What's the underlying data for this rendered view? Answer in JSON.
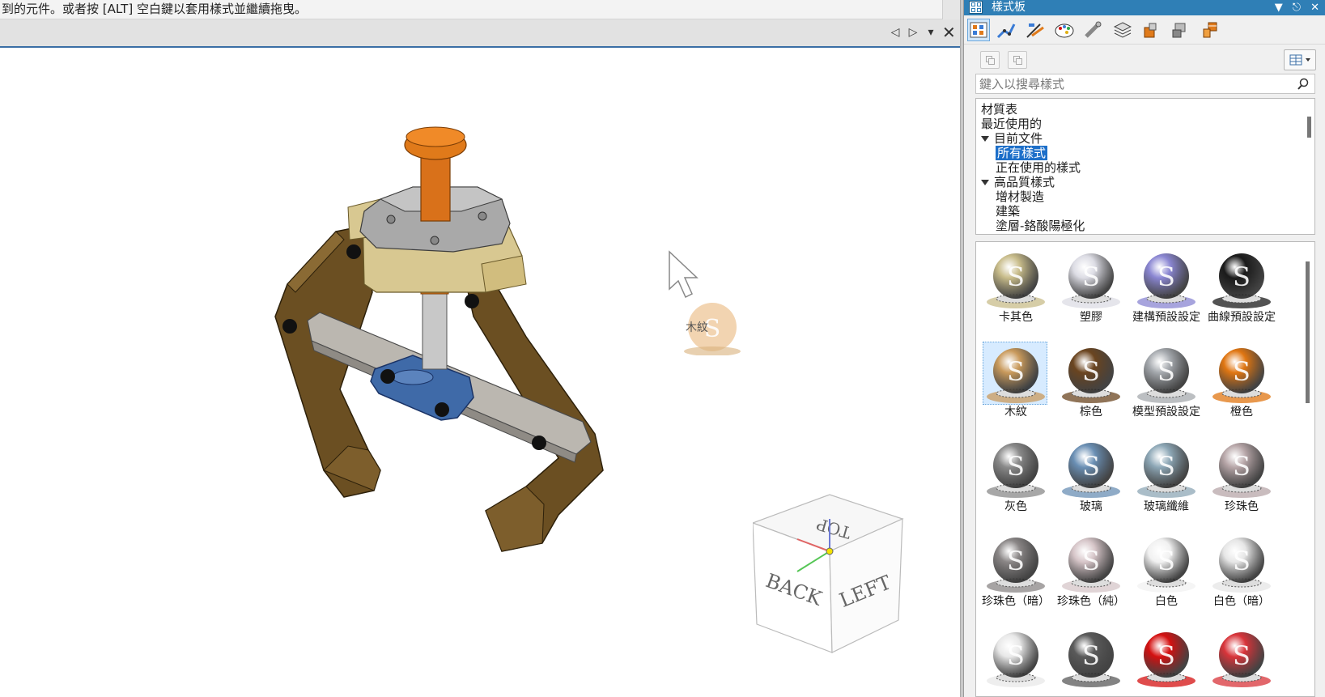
{
  "status_text": "到的元件。或者按 [ALT] 空白鍵以套用樣式並繼續拖曳。",
  "document_tab_controls": {
    "prev_icon": "triangle-left",
    "next_icon": "triangle-right",
    "menu_icon": "chevron-down",
    "close_icon": "close-x"
  },
  "viewport": {
    "drag_ghost_label": "木紋",
    "viewcube": {
      "top": "TOP",
      "back": "BACK",
      "left": "LEFT"
    }
  },
  "panel": {
    "title": "樣式板",
    "title_controls": [
      "chevron-down-icon",
      "pin-icon",
      "close-icon"
    ],
    "toolbar_icons": [
      "style-board-icon",
      "dimension-icon",
      "line-style-icon",
      "render-icon",
      "tube-icon",
      "layer-icon",
      "component-icon",
      "shape-icon",
      "table-icon"
    ],
    "search_placeholder": "鍵入以搜尋樣式",
    "tree": {
      "items": [
        {
          "label": "材質表",
          "level": 0,
          "expanded": false,
          "selected": false
        },
        {
          "label": "最近使用的",
          "level": 0,
          "expanded": false,
          "selected": false
        },
        {
          "label": "目前文件",
          "level": 0,
          "expanded": true,
          "selected": false
        },
        {
          "label": "所有樣式",
          "level": 1,
          "expanded": false,
          "selected": true
        },
        {
          "label": "正在使用的樣式",
          "level": 1,
          "expanded": false,
          "selected": false
        },
        {
          "label": "高品質樣式",
          "level": 0,
          "expanded": true,
          "selected": false
        },
        {
          "label": "增材製造",
          "level": 1,
          "expanded": false,
          "selected": false
        },
        {
          "label": "建築",
          "level": 1,
          "expanded": false,
          "selected": false
        },
        {
          "label": "塗層-鉻酸陽極化",
          "level": 1,
          "expanded": false,
          "selected": false
        }
      ]
    },
    "swatches": [
      {
        "label": "卡其色",
        "color": "#c8bc8a",
        "selected": false
      },
      {
        "label": "塑膠",
        "color": "#dcdce4",
        "selected": false
      },
      {
        "label": "建構預設設定",
        "color": "#8a86d2",
        "selected": false
      },
      {
        "label": "曲線預設設定",
        "color": "#1a1a1a",
        "selected": false
      },
      {
        "label": "木紋",
        "color": "#c99a5c",
        "selected": true
      },
      {
        "label": "棕色",
        "color": "#6b4520",
        "selected": false
      },
      {
        "label": "模型預設設定",
        "color": "#a5a9ae",
        "selected": false
      },
      {
        "label": "橙色",
        "color": "#e07612",
        "selected": false
      },
      {
        "label": "灰色",
        "color": "#8a8a8a",
        "selected": false
      },
      {
        "label": "玻璃",
        "color": "#6a8fb4",
        "selected": false
      },
      {
        "label": "玻璃纖維",
        "color": "#8da7b6",
        "selected": false
      },
      {
        "label": "珍珠色",
        "color": "#b7a6a8",
        "selected": false
      },
      {
        "label": "珍珠色（暗）",
        "color": "#8a8686",
        "selected": false
      },
      {
        "label": "珍珠色（純）",
        "color": "#d6c5c8",
        "selected": false
      },
      {
        "label": "白色",
        "color": "#f1f1f1",
        "selected": false
      },
      {
        "label": "白色（暗）",
        "color": "#e6e6e6",
        "selected": false
      },
      {
        "label": "",
        "color": "#e8e8e8",
        "selected": false
      },
      {
        "label": "",
        "color": "#5a5a5a",
        "selected": false
      },
      {
        "label": "",
        "color": "#d41010",
        "selected": false
      },
      {
        "label": "",
        "color": "#d8343a",
        "selected": false
      }
    ]
  },
  "colors": {
    "panel_titlebar": "#2f7fb6",
    "selection": "#1d6fc9",
    "model_brown": "#6b4f22",
    "model_orange": "#de7b17",
    "model_blue": "#3f6aa8"
  }
}
